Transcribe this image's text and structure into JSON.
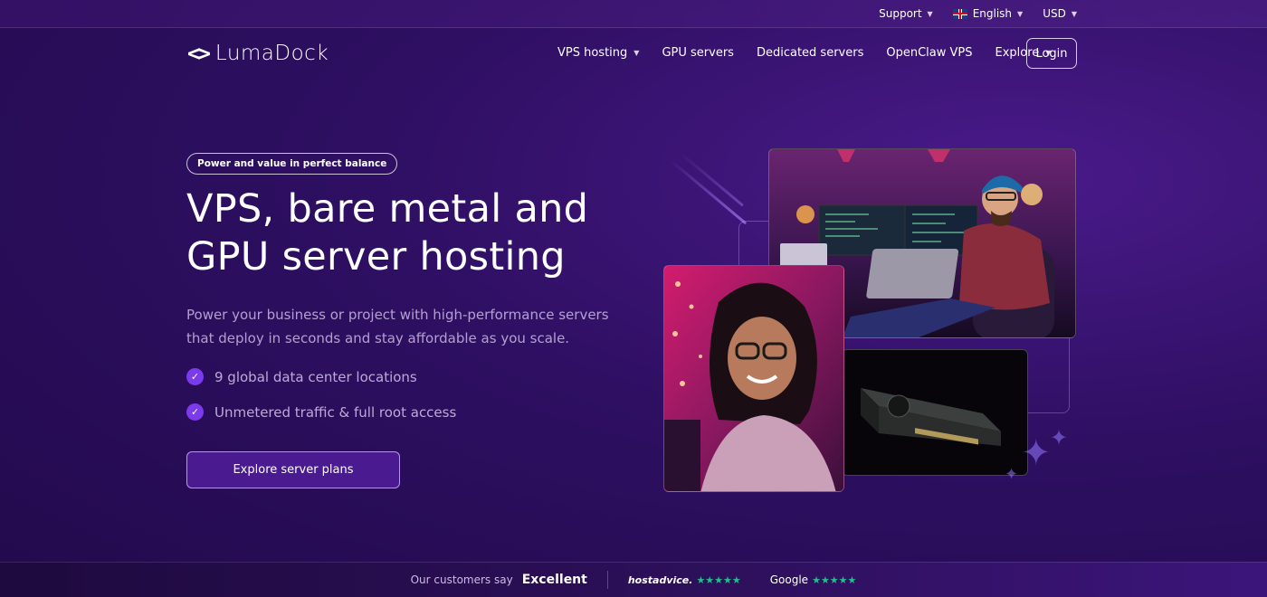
{
  "topbar": {
    "support": "Support",
    "language": "English",
    "currency": "USD"
  },
  "brand": {
    "logo_mark": "<>",
    "name": "LumaDock"
  },
  "nav": {
    "items": [
      {
        "label": "VPS hosting",
        "dropdown": true
      },
      {
        "label": "GPU servers",
        "dropdown": false
      },
      {
        "label": "Dedicated servers",
        "dropdown": false
      },
      {
        "label": "OpenClaw VPS",
        "dropdown": false
      },
      {
        "label": "Explore",
        "dropdown": true
      }
    ],
    "login": "Login"
  },
  "hero": {
    "badge": "Power and value in perfect balance",
    "title_line1": "VPS, bare metal and",
    "title_line2": "GPU server hosting",
    "subtitle": "Power your business or project with high-performance servers that deploy in seconds and stay affordable as you scale.",
    "features": [
      "9 global data center locations",
      "Unmetered traffic & full root access"
    ],
    "cta": "Explore server plans"
  },
  "reviews": {
    "lead": "Our customers say",
    "rating_word": "Excellent",
    "sources": [
      {
        "name": "hostadvice.",
        "stars": 5
      },
      {
        "name": "Google",
        "stars": 5
      }
    ]
  },
  "colors": {
    "accent": "#7c3aed",
    "star": "#22c08a",
    "background": "#2e0f62"
  },
  "icons": {
    "caret": "chevron-down-icon",
    "check": "check-icon",
    "flag": "uk-flag-icon"
  }
}
